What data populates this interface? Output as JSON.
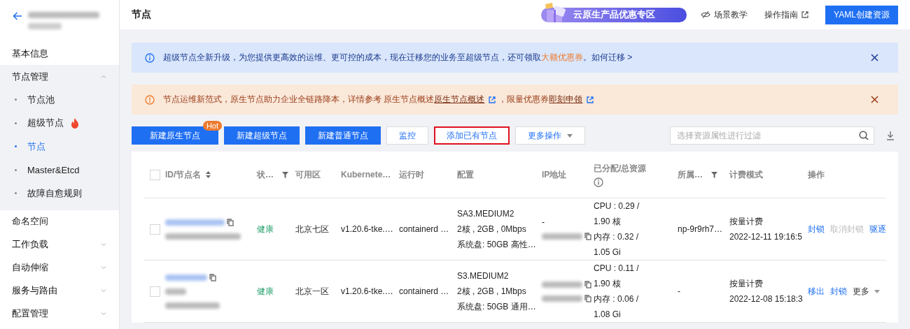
{
  "sidebar": {
    "items": [
      {
        "kind": "item",
        "label": "基本信息"
      },
      {
        "kind": "group",
        "label": "节点管理",
        "expanded": true,
        "children": [
          {
            "label": "节点池",
            "selected": false,
            "hot": false
          },
          {
            "label": "超级节点",
            "selected": false,
            "hot": true
          },
          {
            "label": "节点",
            "selected": true,
            "hot": false
          },
          {
            "label": "Master&Etcd",
            "selected": false,
            "hot": false
          },
          {
            "label": "故障自愈规则",
            "selected": false,
            "hot": false
          }
        ]
      },
      {
        "kind": "item",
        "label": "命名空间"
      },
      {
        "kind": "group",
        "label": "工作负载",
        "expanded": false
      },
      {
        "kind": "group",
        "label": "自动伸缩",
        "expanded": false
      },
      {
        "kind": "group",
        "label": "服务与路由",
        "expanded": false
      },
      {
        "kind": "group",
        "label": "配置管理",
        "expanded": false
      }
    ]
  },
  "header": {
    "title": "节点",
    "promo": "云原生产品优惠专区",
    "links": [
      {
        "kind": "tutorial",
        "label": "场景教学"
      },
      {
        "kind": "external",
        "label": "操作指南"
      }
    ],
    "primary_button": "YAML创建资源"
  },
  "alerts": [
    {
      "kind": "info",
      "segments": [
        {
          "kind": "text",
          "text": "超级节点全新升级，为您提供更高效的运维、更可控的成本，现在迁移您的业务至超级节点，还可领取"
        },
        {
          "kind": "highlight",
          "text": "大额优惠券"
        },
        {
          "kind": "text",
          "text": "。"
        },
        {
          "kind": "link",
          "text": "如何迁移 >"
        }
      ]
    },
    {
      "kind": "warning",
      "segments": [
        {
          "kind": "text",
          "text": "节点运维新范式，原生节点助力企业全链路降本，详情参考 原生节点概述"
        },
        {
          "kind": "external",
          "text": "原生节点概述"
        },
        {
          "kind": "text",
          "text": "，限量优惠券"
        },
        {
          "kind": "external",
          "text": "即刻申领"
        }
      ]
    }
  ],
  "toolbar": {
    "buttons": [
      {
        "kind": "primary",
        "label": "新建原生节点",
        "badge": "Hot",
        "highlighted": false
      },
      {
        "kind": "primary",
        "label": "新建超级节点",
        "highlighted": false
      },
      {
        "kind": "primary",
        "label": "新建普通节点",
        "highlighted": false
      },
      {
        "kind": "default",
        "label": "监控",
        "highlighted": false
      },
      {
        "kind": "default",
        "label": "添加已有节点",
        "highlighted": true
      },
      {
        "kind": "dropdown",
        "label": "更多操作",
        "highlighted": false
      }
    ],
    "search": {
      "placeholder": "选择资源属性进行过滤"
    }
  },
  "table": {
    "select_all": {
      "checked": false
    },
    "columns": [
      {
        "label": "ID/节点名"
      },
      {
        "label": "状…"
      },
      {
        "label": "可用区"
      },
      {
        "label": "Kubernete…"
      },
      {
        "label": "运行时"
      },
      {
        "label": "配置"
      },
      {
        "label": "IP地址"
      },
      {
        "label": "已分配/总资源"
      },
      {
        "label": "所属…"
      },
      {
        "label": "计费模式"
      },
      {
        "label": "操作"
      }
    ],
    "rows": [
      {
        "checked": false,
        "status": "健康",
        "zone": "北京七区",
        "kubernetes": "v1.20.6-tke.…",
        "runtime": "containerd …",
        "config": [
          "SA3.MEDIUM2",
          "2核 , 2GB , 0Mbps",
          "系统盘: 50GB 高性…"
        ],
        "ip_lines": [
          {
            "kind": "text",
            "text": "-"
          },
          {
            "kind": "hidden"
          }
        ],
        "resources": [
          "CPU : 0.29 /",
          "1.90 核",
          "内存 : 0.32 /",
          "1.05 Gi"
        ],
        "node_pool": "np-9r9rh7…",
        "billing": [
          "按量计费",
          "2022-12-11 19:16:5"
        ],
        "actions": [
          {
            "kind": "link",
            "label": "封锁",
            "disabled": false
          },
          {
            "kind": "link",
            "label": "取消封锁",
            "disabled": true
          },
          {
            "kind": "link",
            "label": "驱逐",
            "disabled": false
          }
        ]
      },
      {
        "checked": false,
        "status": "健康",
        "zone": "北京一区",
        "kubernetes": "v1.20.6-tke.…",
        "runtime": "containerd …",
        "config": [
          "S3.MEDIUM2",
          "2核 , 2GB , 1Mbps",
          "系统盘: 50GB 通用…"
        ],
        "ip_lines": [
          {
            "kind": "hidden"
          },
          {
            "kind": "hidden"
          }
        ],
        "resources": [
          "CPU : 0.11 /",
          "1.90 核",
          "内存 : 0.06 /",
          "1.08 Gi"
        ],
        "node_pool": "-",
        "billing": [
          "按量计费",
          "2022-12-08 15:18:3"
        ],
        "actions": [
          {
            "kind": "link",
            "label": "移出",
            "disabled": false
          },
          {
            "kind": "link",
            "label": "封锁",
            "disabled": false
          },
          {
            "kind": "dropdown",
            "label": "更多",
            "disabled": false
          }
        ]
      }
    ]
  }
}
